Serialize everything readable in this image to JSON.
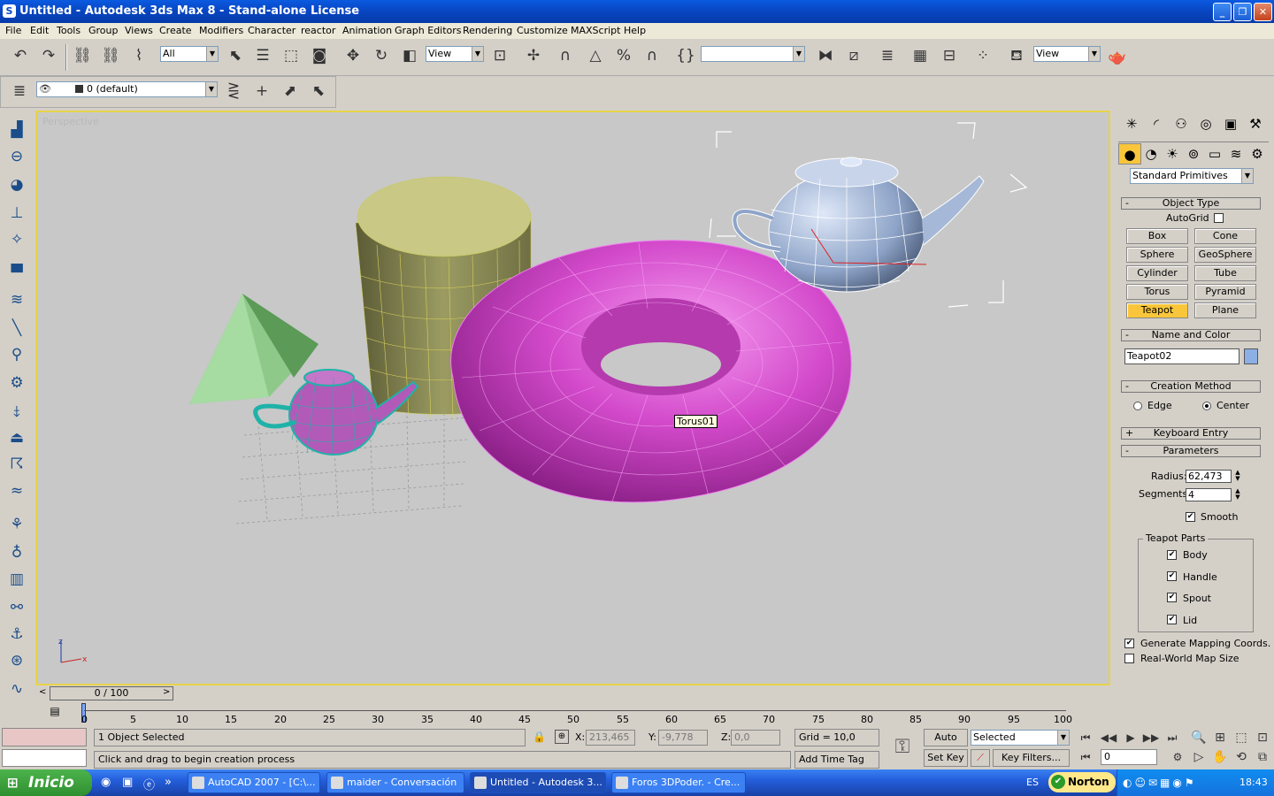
{
  "window": {
    "title": "Untitled - Autodesk 3ds Max 8   - Stand-alone License"
  },
  "menu": [
    "File",
    "Edit",
    "Tools",
    "Group",
    "Views",
    "Create",
    "Modifiers",
    "Character",
    "reactor",
    "Animation",
    "Graph Editors",
    "Rendering",
    "Customize",
    "MAXScript",
    "Help"
  ],
  "toolbar": {
    "selection_filter": "All",
    "ref_coord": "View",
    "named_sel": "",
    "render_combo": "View"
  },
  "layer_toolbar": {
    "layer_name": "0 (default)"
  },
  "viewport": {
    "label": "Perspective",
    "tooltip": "Torus01"
  },
  "command_panel": {
    "primitive_dropdown": "Standard Primitives",
    "object_type": {
      "header": "Object Type",
      "autogrid_label": "AutoGrid",
      "buttons": [
        "Box",
        "Cone",
        "Sphere",
        "GeoSphere",
        "Cylinder",
        "Tube",
        "Torus",
        "Pyramid",
        "Teapot",
        "Plane"
      ],
      "active": "Teapot"
    },
    "name_color": {
      "header": "Name and Color",
      "name_value": "Teapot02",
      "swatch_color": "#8cb0e6"
    },
    "creation_method": {
      "header": "Creation Method",
      "edge_label": "Edge",
      "center_label": "Center"
    },
    "keyboard_entry": {
      "header": "Keyboard Entry"
    },
    "parameters": {
      "header": "Parameters",
      "radius_label": "Radius:",
      "radius_value": "62,473",
      "segments_label": "Segments:",
      "segments_value": "4",
      "smooth_label": "Smooth",
      "teapot_parts_label": "Teapot Parts",
      "body_label": "Body",
      "handle_label": "Handle",
      "spout_label": "Spout",
      "lid_label": "Lid",
      "gen_mapping_label": "Generate Mapping Coords.",
      "real_world_label": "Real-World Map Size"
    }
  },
  "timeline": {
    "slider_text": "0 / 100",
    "ticks": [
      "0",
      "5",
      "10",
      "15",
      "20",
      "25",
      "30",
      "35",
      "40",
      "45",
      "50",
      "55",
      "60",
      "65",
      "70",
      "75",
      "80",
      "85",
      "90",
      "95",
      "100"
    ]
  },
  "status": {
    "selection": "1 Object Selected",
    "prompt": "Click and drag to begin creation process",
    "x_label": "X:",
    "x_value": "213,465",
    "y_label": "Y:",
    "y_value": "-9,778",
    "z_label": "Z:",
    "z_value": "0,0",
    "grid": "Grid = 10,0",
    "add_time_tag": "Add Time Tag",
    "auto_key": "Auto Key",
    "set_key": "Set Key",
    "selected_combo": "Selected",
    "key_filters": "Key Filters...",
    "frame_value": "0"
  },
  "taskbar": {
    "start_label": "Inicio",
    "tasks": [
      "AutoCAD 2007 - [C:\\...",
      "maider - Conversación",
      "Untitled - Autodesk 3...",
      "Foros 3DPoder. - Cre..."
    ],
    "lang": "ES",
    "norton": "Norton",
    "clock": "18:43"
  }
}
